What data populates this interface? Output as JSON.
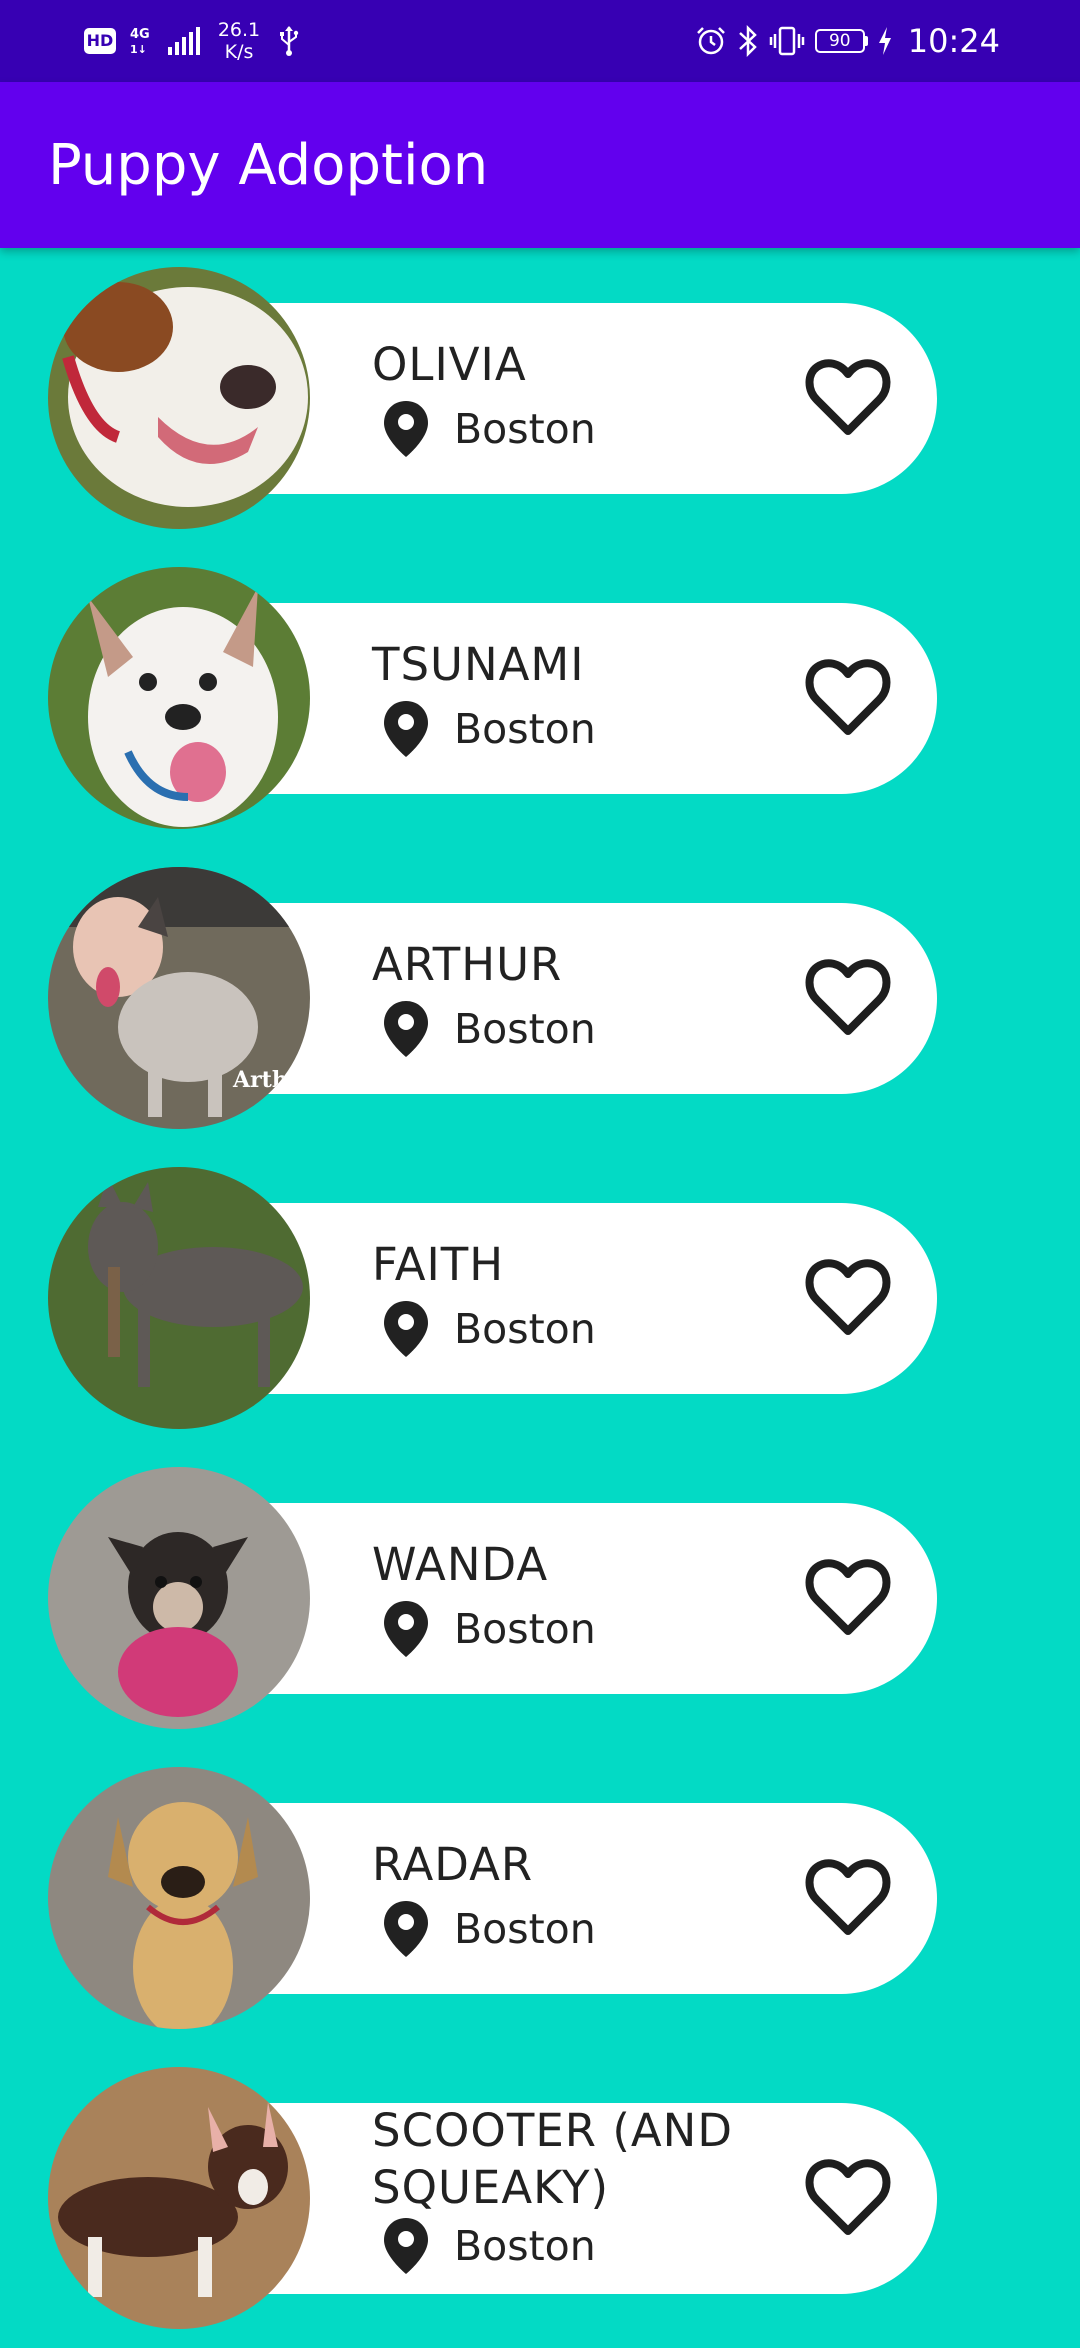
{
  "status_bar": {
    "hd": "HD",
    "network_top": "4G",
    "network_bottom": "1↓",
    "speed_value": "26.1",
    "speed_unit": "K/s",
    "battery": "90",
    "time": "10:24"
  },
  "app_bar": {
    "title": "Puppy Adoption"
  },
  "puppies": [
    {
      "name": "OLIVIA",
      "location": "Boston",
      "photo_colors": {
        "bg": "#6b7a3a",
        "fur": "#f2efe9",
        "patch": "#8a4a22"
      }
    },
    {
      "name": "TSUNAMI",
      "location": "Boston",
      "photo_colors": {
        "bg": "#5c7d35",
        "fur": "#f4f2ef",
        "patch": "#c49a88"
      }
    },
    {
      "name": "ARTHUR",
      "location": "Boston",
      "photo_colors": {
        "bg": "#706a5c",
        "fur": "#c9c3bd",
        "patch": "#4a4442"
      }
    },
    {
      "name": "FAITH",
      "location": "Boston",
      "photo_colors": {
        "bg": "#4f6b32",
        "fur": "#5e5956",
        "patch": "#7a6148"
      }
    },
    {
      "name": "WANDA",
      "location": "Boston",
      "photo_colors": {
        "bg": "#9e9a94",
        "fur": "#2d2826",
        "patch": "#d13a78"
      }
    },
    {
      "name": "RADAR",
      "location": "Boston",
      "photo_colors": {
        "bg": "#8e8880",
        "fur": "#d9b06e",
        "patch": "#b38a4f"
      }
    },
    {
      "name": "SCOOTER (AND SQUEAKY)",
      "location": "Boston",
      "photo_colors": {
        "bg": "#a9825a",
        "fur": "#4a2a1e",
        "patch": "#f1ece6"
      }
    }
  ]
}
